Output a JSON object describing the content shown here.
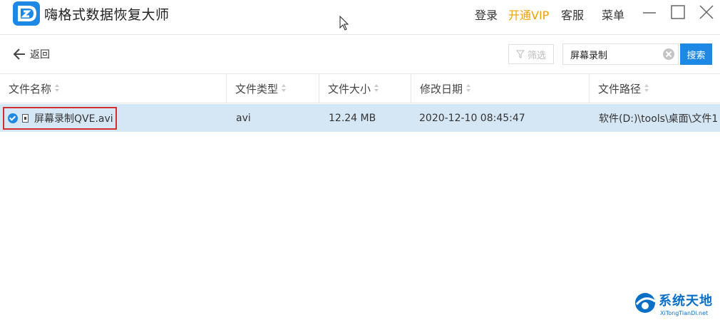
{
  "app": {
    "title": "嗨格式数据恢复大师"
  },
  "topbar": {
    "login": "登录",
    "vip": "开通VIP",
    "service": "客服",
    "menu": "菜单"
  },
  "toolbar": {
    "back_label": "返回",
    "filter_label": "筛选",
    "search_value": "屏幕录制",
    "search_button": "搜索"
  },
  "table": {
    "columns": [
      "文件名称",
      "文件类型",
      "文件大小",
      "修改日期",
      "文件路径"
    ],
    "rows": [
      {
        "name": "屏幕录制QVE.avi",
        "type": "avi",
        "size": "12.24 MB",
        "date": "2020-12-10 08:45:47",
        "path": "软件(D:)\\tools\\桌面\\文件1",
        "selected": true
      }
    ]
  },
  "watermark": {
    "text": "系统天地",
    "sub": "XiTongTianDi.net"
  },
  "colors": {
    "accent": "#1e88e5",
    "vip": "#f0a000",
    "selected_row": "#d5e6f5",
    "highlight_border": "#d32f2f"
  }
}
